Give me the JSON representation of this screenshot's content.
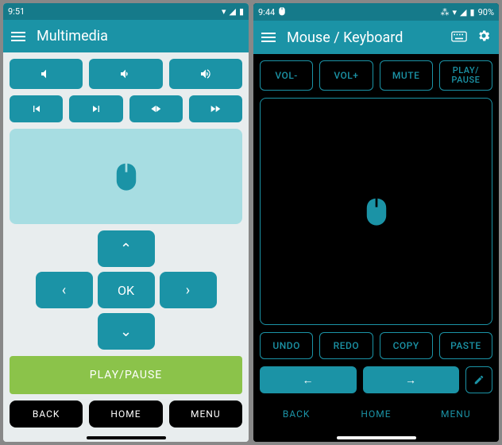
{
  "left": {
    "status": {
      "time": "9:51"
    },
    "title": "Multimedia",
    "dpad_ok": "OK",
    "play_pause": "PLAY/PAUSE",
    "nav": {
      "back": "BACK",
      "home": "HOME",
      "menu": "MENU"
    },
    "colors": {
      "bg": "#e8edee",
      "appbar": "#1b93a6",
      "statusbar": "#157a8a",
      "touchpad": "#a7dde2",
      "play": "#8bc34a"
    }
  },
  "right": {
    "status": {
      "time": "9:44",
      "battery": "90%"
    },
    "title": "Mouse / Keyboard",
    "top_buttons": [
      "VOL-",
      "VOL+",
      "MUTE",
      "PLAY/\nPAUSE"
    ],
    "bottom_buttons": [
      "UNDO",
      "REDO",
      "COPY",
      "PASTE"
    ],
    "arrows": [
      "←",
      "→"
    ],
    "nav": {
      "back": "BACK",
      "home": "HOME",
      "menu": "MENU"
    },
    "colors": {
      "bg": "#000000",
      "appbar": "#1b93a6",
      "statusbar": "#157a8a"
    }
  }
}
